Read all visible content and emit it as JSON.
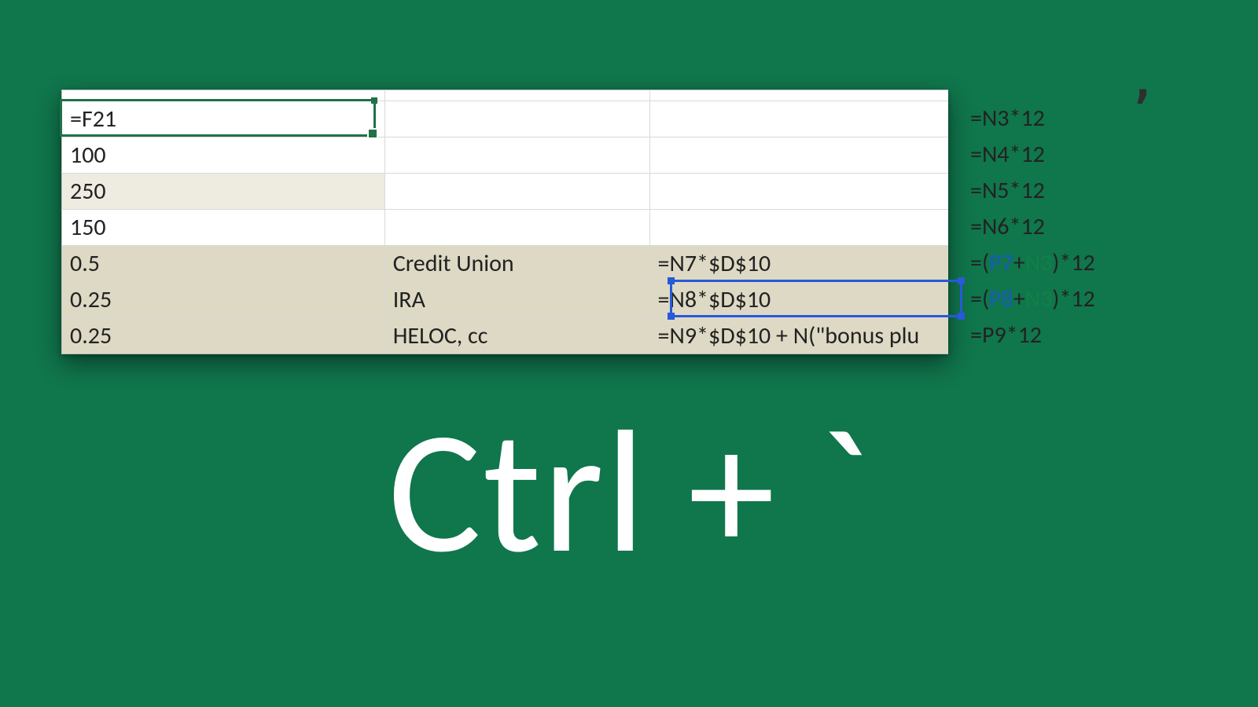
{
  "shortcut_label": "Ctrl + `",
  "columns": [
    "value",
    "label",
    "formula1",
    "formula2"
  ],
  "rows": [
    {
      "value": "=F21",
      "label": "",
      "formula1": "",
      "formula2": "=N3*12"
    },
    {
      "value": "100",
      "label": "",
      "formula1": "",
      "formula2": "=N4*12"
    },
    {
      "value": "250",
      "label": "",
      "formula1": "",
      "formula2": "=N5*12"
    },
    {
      "value": "150",
      "label": "",
      "formula1": "",
      "formula2": "=N6*12"
    },
    {
      "value": "0.5",
      "label": "Credit Union",
      "formula1": "=N7*$D$10",
      "formula2": "=(P7+N3)*12",
      "formula2_parts": [
        "=(",
        "P7",
        "+",
        "N3",
        ")*12"
      ]
    },
    {
      "value": "0.25",
      "label": "IRA",
      "formula1": "=N8*$D$10",
      "formula2": "=(P8+N3)*12",
      "formula2_parts": [
        "=(",
        "P8",
        "+",
        "N3",
        ")*12"
      ]
    },
    {
      "value": "0.25",
      "label": "HELOC, cc",
      "formula1": "=N9*$D$10 + N(\"bonus plu",
      "formula2": "=P9*12"
    }
  ],
  "active_cell_index": 0,
  "copy_marquee_cell": {
    "row_index": 5,
    "col": "formula1"
  },
  "row_bg": [
    "white",
    "white",
    "alt",
    "white",
    "shade",
    "shade",
    "shade"
  ]
}
